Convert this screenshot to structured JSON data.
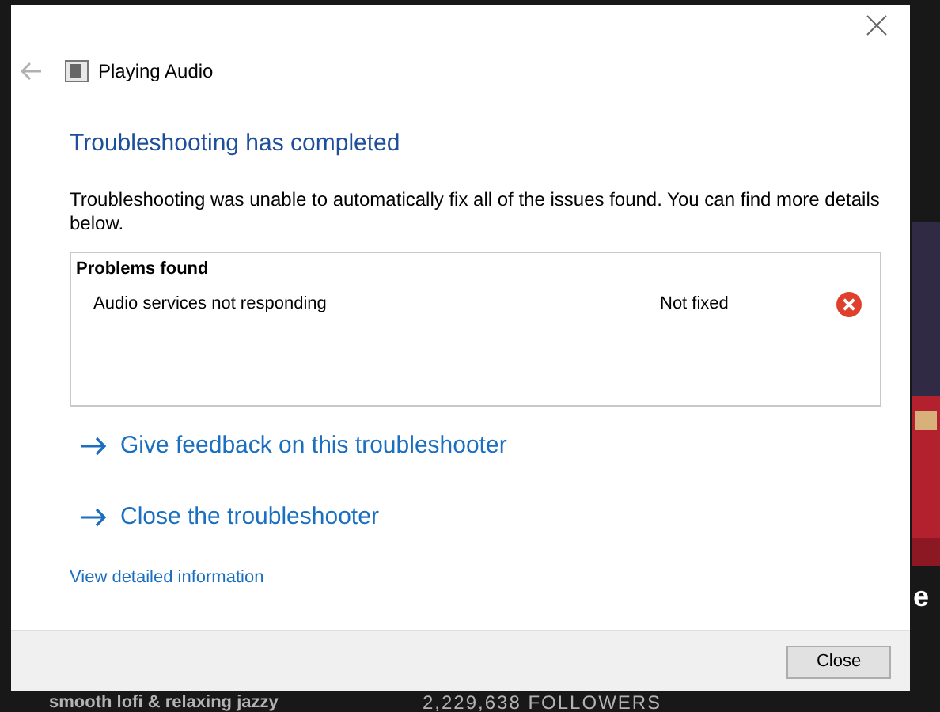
{
  "background": {
    "side_title": "e",
    "description": "smooth lofi & relaxing jazzy",
    "followers": "2,229,638 FOLLOWERS"
  },
  "window": {
    "title": "Playing Audio",
    "heading": "Troubleshooting has completed",
    "message": "Troubleshooting was unable to automatically fix all of the issues found. You can find more details below.",
    "problems": {
      "title": "Problems found",
      "rows": [
        {
          "name": "Audio services not responding",
          "status": "Not fixed",
          "kind": "error"
        }
      ]
    },
    "links": [
      "Give feedback on this troubleshooter",
      "Close the troubleshooter"
    ],
    "details_link": "View detailed information",
    "buttons": [
      "Close"
    ]
  }
}
